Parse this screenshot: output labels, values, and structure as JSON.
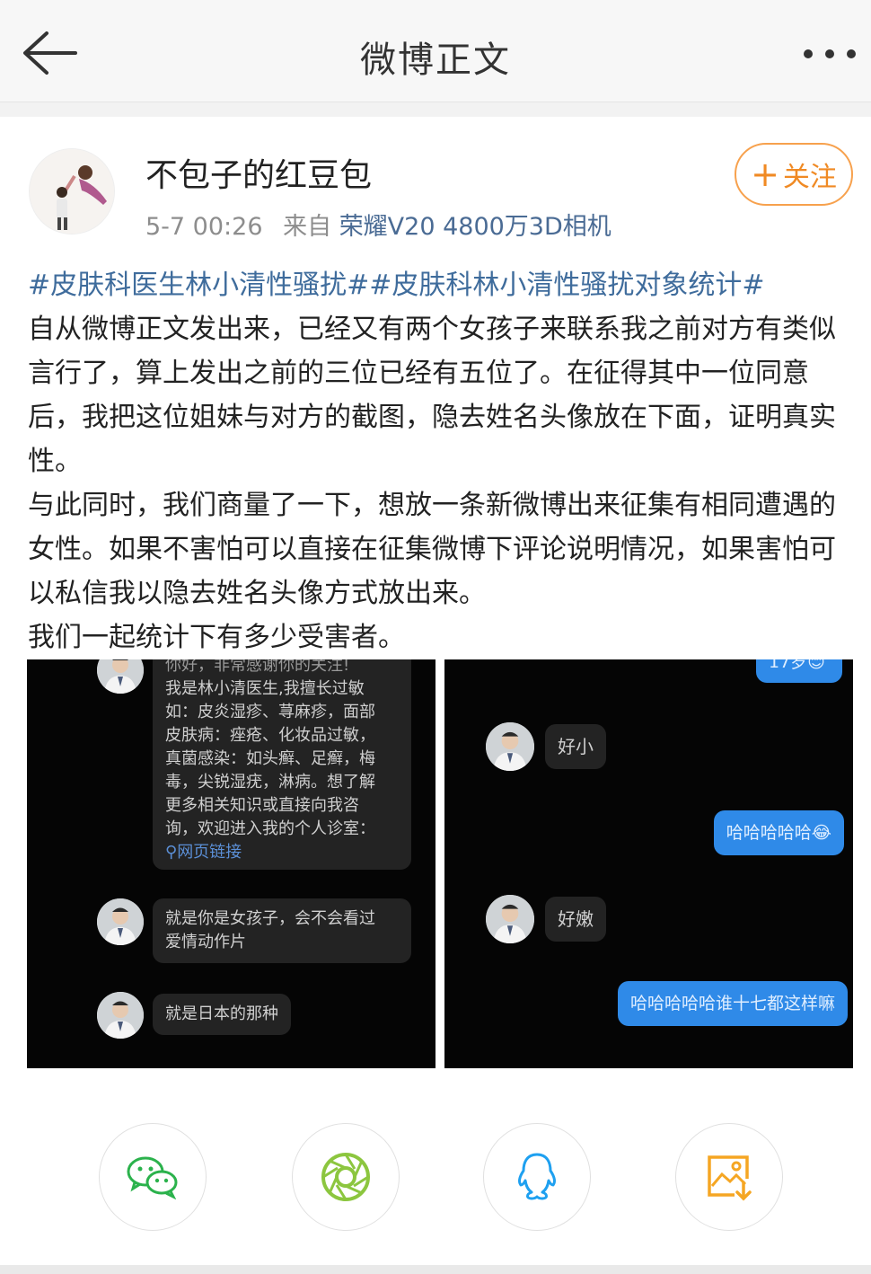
{
  "header": {
    "title": "微博正文",
    "back_icon": "back-arrow-icon",
    "more_icon": "more-dots-icon"
  },
  "author": {
    "name": "不包子的红豆包",
    "time": "5-7 00:26",
    "from_label": "来自",
    "source": "荣耀V20 4800万3D相机",
    "follow_label": "关注"
  },
  "post": {
    "tag1": "#皮肤科医生林小清性骚扰#",
    "tag2": "#皮肤科林小清性骚扰对象统计#",
    "paragraphs": [
      "自从微博正文发出来，已经又有两个女孩子来联系我之前对方有类似言行了，算上发出之前的三位已经有五位了。在征得其中一位同意后，我把这位姐妹与对方的截图，隐去姓名头像放在下面，证明真实性。",
      "与此同时，我们商量了一下，想放一条新微博出来征集有相同遭遇的女性。如果不害怕可以直接在征集微博下评论说明情况，如果害怕可以私信我以隐去姓名头像方式放出来。",
      "我们一起统计下有多少受害者。"
    ]
  },
  "images": {
    "left": {
      "bubble1_top": "你好，非常感谢你的关注!",
      "bubble1_lines": [
        "我是林小清医生,我擅长过敏",
        "如：皮炎湿疹、荨麻疹，面部",
        "皮肤病：痤疮、化妆品过敏，",
        "真菌感染：如头癣、足癣，梅",
        "毒，尖锐湿疣，淋病。想了解",
        "更多相关知识或直接向我咨",
        "询，欢迎进入我的个人诊室："
      ],
      "bubble1_link": "网页链接",
      "bubble2_lines": [
        "就是你是女孩子，会不会看过",
        "爱情动作片"
      ],
      "bubble3": "就是日本的那种"
    },
    "right": {
      "top_bubble": "17岁😊",
      "msg1": "好小",
      "msg2": "哈哈哈哈哈😂",
      "msg3": "好嫩",
      "msg4": "哈哈哈哈哈谁十七都这样嘛"
    }
  },
  "share": [
    {
      "name": "wechat",
      "icon": "wechat-icon",
      "color": "#2bb24c"
    },
    {
      "name": "moments",
      "icon": "moments-icon",
      "color": "#8cc63f"
    },
    {
      "name": "qq",
      "icon": "qq-icon",
      "color": "#1ea0f0"
    },
    {
      "name": "save-image",
      "icon": "save-image-icon",
      "color": "#f5a623"
    }
  ]
}
